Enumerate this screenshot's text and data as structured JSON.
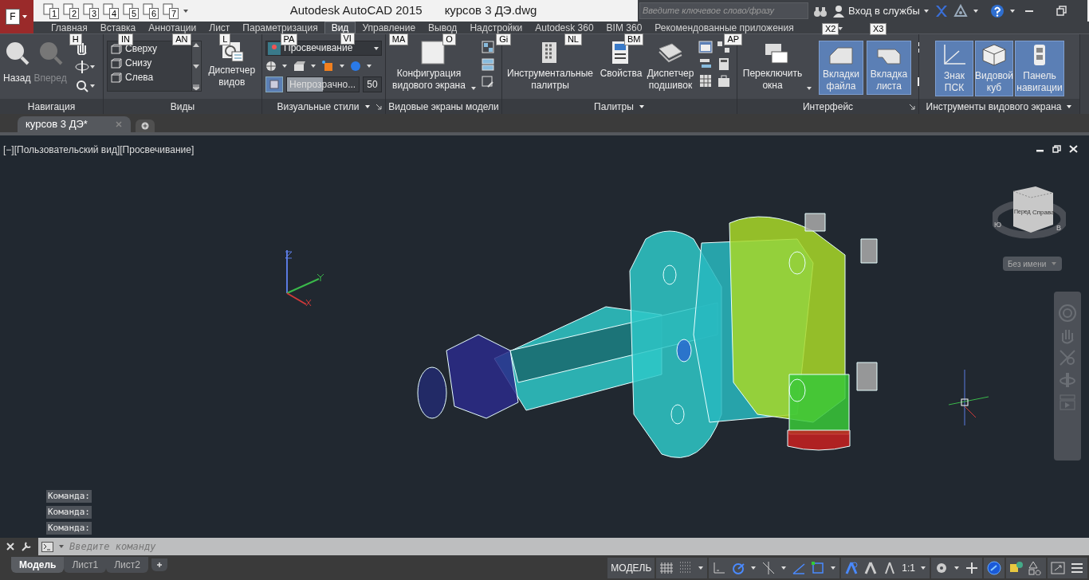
{
  "app_menu": {
    "keytip": "F"
  },
  "quick_access": [
    {
      "keytip": "1"
    },
    {
      "keytip": "2"
    },
    {
      "keytip": "3"
    },
    {
      "keytip": "4"
    },
    {
      "keytip": "5"
    },
    {
      "keytip": "6"
    },
    {
      "keytip": "7"
    }
  ],
  "title": {
    "app": "Autodesk AutoCAD 2015",
    "file": "курсов 3 ДЭ.dwg"
  },
  "search": {
    "placeholder": "Введите ключевое слово/фразу"
  },
  "sign_in": "Вход в службы",
  "tabs": [
    {
      "label": "Главная",
      "keytip": "H",
      "selected": false
    },
    {
      "label": "Вставка",
      "keytip": "IN",
      "selected": false
    },
    {
      "label": "Аннотации",
      "keytip": "AN",
      "selected": false
    },
    {
      "label": "Лист",
      "keytip": "L",
      "selected": false
    },
    {
      "label": "Параметризация",
      "keytip": "PA",
      "selected": false
    },
    {
      "label": "Вид",
      "keytip": "VI",
      "selected": true
    },
    {
      "label": "Управление",
      "keytip": "MA",
      "selected": false
    },
    {
      "label": "Вывод",
      "keytip": "O",
      "selected": false
    },
    {
      "label": "Надстройки",
      "keytip": "Gi",
      "selected": false
    },
    {
      "label": "Autodesk 360",
      "keytip": "NL",
      "selected": false
    },
    {
      "label": "BIM 360",
      "keytip": "BM",
      "selected": false
    },
    {
      "label": "Рекомендованные приложения",
      "keytip": "AP",
      "selected": false
    }
  ],
  "panels": [
    {
      "kind": "navigation",
      "title": "Навигация",
      "buttons": [
        {
          "label": "Назад",
          "disabled": false
        },
        {
          "label": "Вперед",
          "disabled": true
        }
      ]
    },
    {
      "kind": "views",
      "title": "Виды",
      "views": [
        "Сверху",
        "Снизу",
        "Слева"
      ],
      "button": "Диспетчер видов"
    },
    {
      "kind": "visual_styles",
      "title": "Визуальные стили",
      "style": "Просвечивание",
      "opacity_label": "Непрозрачно...",
      "opacity_value": "50",
      "level": 0.5
    },
    {
      "kind": "viewports",
      "title": "Видовые экраны модели",
      "button": "Конфигурация видового экрана"
    },
    {
      "kind": "palettes",
      "title": "Палитры",
      "buttons": [
        "Инструментальные палитры",
        "Свойства",
        "Диспетчер подшивок"
      ]
    },
    {
      "kind": "interface",
      "title": "Интерфейс",
      "buttons": [
        {
          "label": "Переключить окна",
          "selected": false
        },
        {
          "label": "Вкладки файла",
          "selected": true,
          "keytip": "X2"
        },
        {
          "label": "Вкладка листа",
          "selected": true,
          "keytip": "X3"
        }
      ]
    },
    {
      "kind": "viewport_tools",
      "title": "Инструменты видового экрана",
      "buttons": [
        {
          "label": "Знак ПСК",
          "selected": true
        },
        {
          "label": "Видовой куб",
          "selected": true
        },
        {
          "label": "Панель навигации",
          "selected": true
        }
      ]
    }
  ],
  "file_tabs": [
    {
      "label": "курсов 3 ДЭ*",
      "selected": true
    }
  ],
  "viewport": {
    "label": "[−][Пользовательский вид][Просвечивание]",
    "viewcube_faces": [
      "Перед",
      "Справа"
    ],
    "compass": [
      "Ю",
      "В"
    ],
    "named_view": "Без имени"
  },
  "command_history": [
    "Команда:",
    "Команда:",
    "Команда:"
  ],
  "command_line": {
    "placeholder": "Введите команду"
  },
  "layout_tabs": [
    {
      "label": "Модель",
      "selected": true
    },
    {
      "label": "Лист1",
      "selected": false
    },
    {
      "label": "Лист2",
      "selected": false
    }
  ],
  "status_bar": {
    "space": "МОДЕЛЬ",
    "scale": "1:1"
  }
}
